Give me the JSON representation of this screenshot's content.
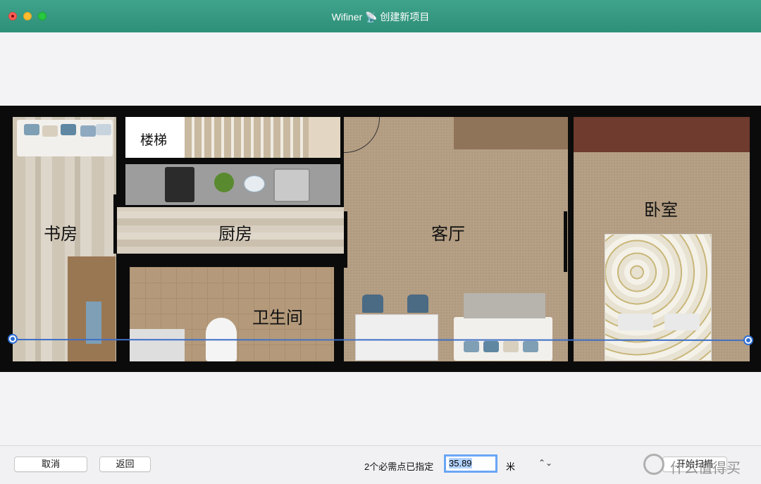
{
  "window": {
    "title": "Wifiner 📡 创建新项目"
  },
  "floorplan": {
    "rooms": {
      "study": "书房",
      "stairs": "楼梯",
      "kitchen": "厨房",
      "living": "客厅",
      "bedroom": "卧室",
      "bathroom": "卫生间"
    }
  },
  "footer": {
    "cancel_label": "取消",
    "back_label": "返回",
    "status_text": "2个必需点已指定",
    "distance_value": "35.89",
    "unit_label": "米",
    "stepper_glyph": "⌃⌄",
    "start_label": "开始扫描",
    "watermark_text": "什么值得买"
  }
}
